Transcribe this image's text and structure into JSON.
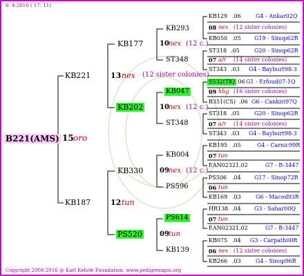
{
  "header": {
    "date_text": "6- 4-2016 ( 17: 11)"
  },
  "footer": {
    "copyright": "Copyright 2008-2016 @ Karl Kehrle Foundation.    www.pedigreeapis.org"
  },
  "colors": {
    "frame": "#cc00cc",
    "highlight_green": "#33ee33",
    "highlight_pink": "#ffccff",
    "queen_text": "#c00000",
    "ref_text": "#0000cc"
  },
  "root": {
    "name": "B221(AMS)",
    "year": "15",
    "race": "oro"
  },
  "gen1": [
    {
      "name": "KB221",
      "year": "13",
      "race": "nex",
      "note": "(12 sister colonies)"
    },
    {
      "name": "KB187",
      "year": "12",
      "race": "tun"
    }
  ],
  "gen2": [
    {
      "name": "KB177",
      "year": "10",
      "race": "nex",
      "note": "(12 c.)"
    },
    {
      "name": "KB202",
      "year": "10",
      "race": "nex",
      "note": "(12 c.)"
    },
    {
      "name": "KB330",
      "year": "09",
      "race": "nex",
      "note": "(12 c.)"
    },
    {
      "name": "PS520",
      "year": "09",
      "race": "tun"
    }
  ],
  "gen3": [
    {
      "name": "KB293",
      "year": "08",
      "race": "nex",
      "note": "(12 sister colonies)"
    },
    {
      "name": "ST348",
      "year": "07",
      "race": "a/r",
      "note": "(14 sister colonies)"
    },
    {
      "name": "KB047",
      "year": "09",
      "race": "hbg",
      "note": "(16 sister colonies)"
    },
    {
      "name": "ST348",
      "year": "07",
      "race": "a/r",
      "note": "(14 sister colonies)"
    },
    {
      "name": "KB004",
      "year": "07",
      "race": "tun"
    },
    {
      "name": "PS596",
      "year": "06",
      "race": "tun"
    },
    {
      "name": "PS614",
      "year": "07",
      "race": "tun"
    },
    {
      "name": "KB139",
      "year": "06",
      "race": "nex",
      "note": "(12 sister colonies)"
    }
  ],
  "gen4": [
    {
      "name": "KB129",
      "yr": ".06",
      "ref": "G4 - Ankar02Q"
    },
    {
      "name": "KB050",
      "yr": ".05",
      "ref": "G19 - Sinop62R"
    },
    {
      "name": "ST318",
      "yr": ".05",
      "ref": "G20 - Sinop62R"
    },
    {
      "name": "ST343",
      "yr": ".03",
      "ref": "G4 - Bayburt98-3"
    },
    {
      "name": "S532(TK)",
      "yr": ".06",
      "ref": "G1 - Erfoud07-1Q"
    },
    {
      "name": "B351(CS)",
      "yr": ".06",
      "ref": "G6 - Cankiri97Q"
    },
    {
      "name": "ST318",
      "yr": ".05",
      "ref": "G20 - Sinop62R"
    },
    {
      "name": "ST343",
      "yr": ".03",
      "ref": "G4 - Bayburt98-3"
    },
    {
      "name": "KB195",
      "yr": ".05",
      "ref": "G4 - Carnic99R"
    },
    {
      "name": "EAN02321",
      "yr": ".02",
      "ref": "G7 - B-3447"
    },
    {
      "name": "PS506",
      "yr": ".04",
      "ref": "G17 - Sinop72R"
    },
    {
      "name": "KB169",
      "yr": ".03",
      "ref": "G6 - Maced93R"
    },
    {
      "name": "HR138",
      "yr": ".04",
      "ref": "G3 - Sahar00Q"
    },
    {
      "name": "EAN02321",
      "yr": ".02",
      "ref": "G7 - B-3447"
    },
    {
      "name": "KB075",
      "yr": ".04",
      "ref": "G3 - Carpath00R"
    },
    {
      "name": "KB266",
      "yr": ".03",
      "ref": "G4 - Sinop96R"
    }
  ]
}
